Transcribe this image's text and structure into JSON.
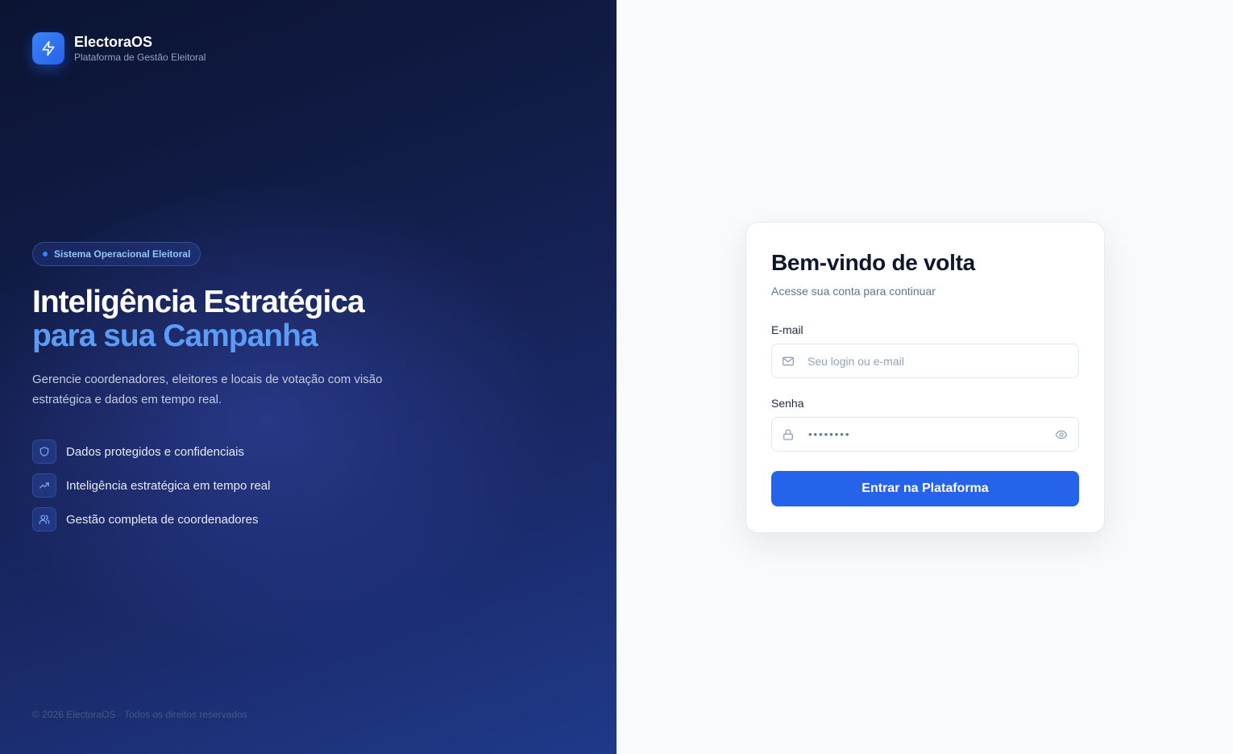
{
  "brand": {
    "name": "ElectoraOS",
    "subtitle": "Plataforma de Gestão Eleitoral",
    "icon": "lightning-icon"
  },
  "hero": {
    "badge": "Sistema Operacional Eleitoral",
    "headline_line1": "Inteligência Estratégica",
    "headline_line2": "para sua Campanha",
    "description": "Gerencie coordenadores, eleitores e locais de votação com visão estratégica e dados em tempo real.",
    "features": [
      {
        "icon": "shield-icon",
        "label": "Dados protegidos e confidenciais"
      },
      {
        "icon": "trending-up-icon",
        "label": "Inteligência estratégica em tempo real"
      },
      {
        "icon": "users-icon",
        "label": "Gestão completa de coordenadores"
      }
    ]
  },
  "footer": {
    "text": "© 2026 ElectoraOS · Todos os direitos reservados"
  },
  "login": {
    "title": "Bem-vindo de volta",
    "subtitle": "Acesse sua conta para continuar",
    "email_label": "E-mail",
    "email_placeholder": "Seu login ou e-mail",
    "email_value": "",
    "password_label": "Senha",
    "password_value": "••••••••",
    "submit_label": "Entrar na Plataforma"
  },
  "colors": {
    "accent": "#2563eb",
    "headline_highlight": "#5b9cf6",
    "panel_dark": "#121d4a"
  }
}
